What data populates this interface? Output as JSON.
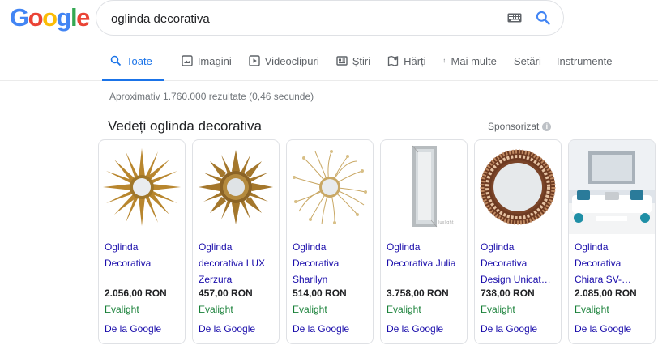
{
  "logo": {
    "letters": [
      "G",
      "o",
      "o",
      "g",
      "l",
      "e"
    ],
    "colors": [
      "#4285f4",
      "#ea4335",
      "#fbbc05",
      "#4285f4",
      "#34a853",
      "#ea4335"
    ]
  },
  "search": {
    "query": "oglinda decorativa",
    "keyboard_icon": "keyboard-icon",
    "search_icon": "search-icon"
  },
  "tabs": [
    {
      "label": "Toate",
      "icon": "search-icon",
      "active": true
    },
    {
      "label": "Imagini",
      "icon": "image-icon"
    },
    {
      "label": "Videoclipuri",
      "icon": "video-icon"
    },
    {
      "label": "Știri",
      "icon": "news-icon"
    },
    {
      "label": "Hărți",
      "icon": "map-icon"
    },
    {
      "label": "Mai multe",
      "icon": "more-vert-icon"
    },
    {
      "label": "Setări"
    },
    {
      "label": "Instrumente"
    }
  ],
  "stats": "Aproximativ 1.760.000 rezultate (0,46 secunde)",
  "shopping": {
    "title": "Vedeți oglinda decorativa",
    "sponsored": "Sponsorizat",
    "products": [
      {
        "name": "Oglinda Decorativa",
        "price": "2.056,00 RON",
        "seller": "Evalight",
        "via": "De la Google",
        "image": "sun-mirror-gold"
      },
      {
        "name": "Oglinda decorativa LUX Zerzura",
        "price": "457,00 RON",
        "seller": "Evalight",
        "via": "De la Google",
        "image": "star-mirror-gold"
      },
      {
        "name": "Oglinda Decorativa Sharilyn",
        "price": "514,00 RON",
        "seller": "Evalight",
        "via": "De la Google",
        "image": "wire-sun-mirror"
      },
      {
        "name": "Oglinda Decorativa Julia",
        "price": "3.758,00 RON",
        "seller": "Evalight",
        "via": "De la Google",
        "image": "tall-rect-mirror"
      },
      {
        "name": "Oglinda Decorativa Design Unicat…",
        "price": "738,00 RON",
        "seller": "Evalight",
        "via": "De la Google",
        "image": "round-mosaic-mirror"
      },
      {
        "name": "Oglinda Decorativa Chiara SV-…",
        "price": "2.085,00 RON",
        "seller": "Evalight",
        "via": "De la Google",
        "image": "living-room-mirror"
      }
    ]
  },
  "colors": {
    "accent": "#1a73e8",
    "link": "#1a0dab",
    "seller": "#188038"
  }
}
